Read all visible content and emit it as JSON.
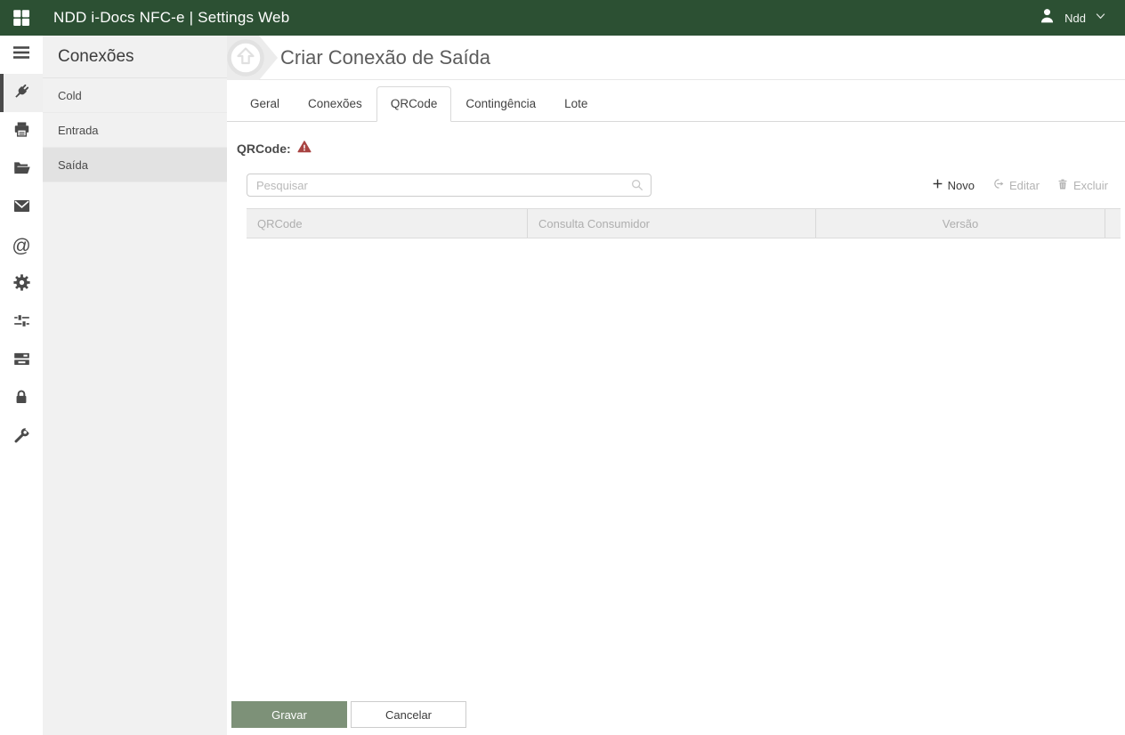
{
  "topbar": {
    "app_title": "NDD i-Docs NFC-e | Settings Web",
    "user_name": "Ndd"
  },
  "icon_rail": {
    "items": [
      {
        "icon": "menu-icon",
        "active": false
      },
      {
        "icon": "plug-icon",
        "active": true
      },
      {
        "icon": "printer-icon",
        "active": false
      },
      {
        "icon": "folder-open-icon",
        "active": false
      },
      {
        "icon": "envelope-icon",
        "active": false
      },
      {
        "icon": "at-sign-icon",
        "active": false
      },
      {
        "icon": "gear-icon",
        "active": false
      },
      {
        "icon": "sliders-icon",
        "active": false
      },
      {
        "icon": "server-icon",
        "active": false
      },
      {
        "icon": "lock-icon",
        "active": false
      },
      {
        "icon": "wrench-icon",
        "active": false
      }
    ],
    "at_glyph": "@"
  },
  "sidebar": {
    "title": "Conexões",
    "items": [
      {
        "label": "Cold",
        "selected": false
      },
      {
        "label": "Entrada",
        "selected": false
      },
      {
        "label": "Saída",
        "selected": true
      }
    ]
  },
  "main": {
    "page_title": "Criar Conexão de Saída",
    "tabs": [
      {
        "label": "Geral",
        "active": false
      },
      {
        "label": "Conexões",
        "active": false
      },
      {
        "label": "QRCode",
        "active": true
      },
      {
        "label": "Contingência",
        "active": false
      },
      {
        "label": "Lote",
        "active": false
      }
    ],
    "section_label": "QRCode:",
    "section_warning_icon": "warning-triangle-icon",
    "search_placeholder": "Pesquisar",
    "toolbar": {
      "new_label": "Novo",
      "edit_label": "Editar",
      "delete_label": "Excluir",
      "edit_enabled": false,
      "delete_enabled": false
    },
    "table": {
      "columns": [
        "QRCode",
        "Consulta Consumidor",
        "Versão"
      ],
      "rows": []
    },
    "footer": {
      "save_label": "Gravar",
      "cancel_label": "Cancelar"
    }
  },
  "colors": {
    "topbar_bg": "#2c5033",
    "save_green": "#7d9178",
    "warning_red": "#a94442",
    "rail_icon": "#4a4a4a"
  }
}
